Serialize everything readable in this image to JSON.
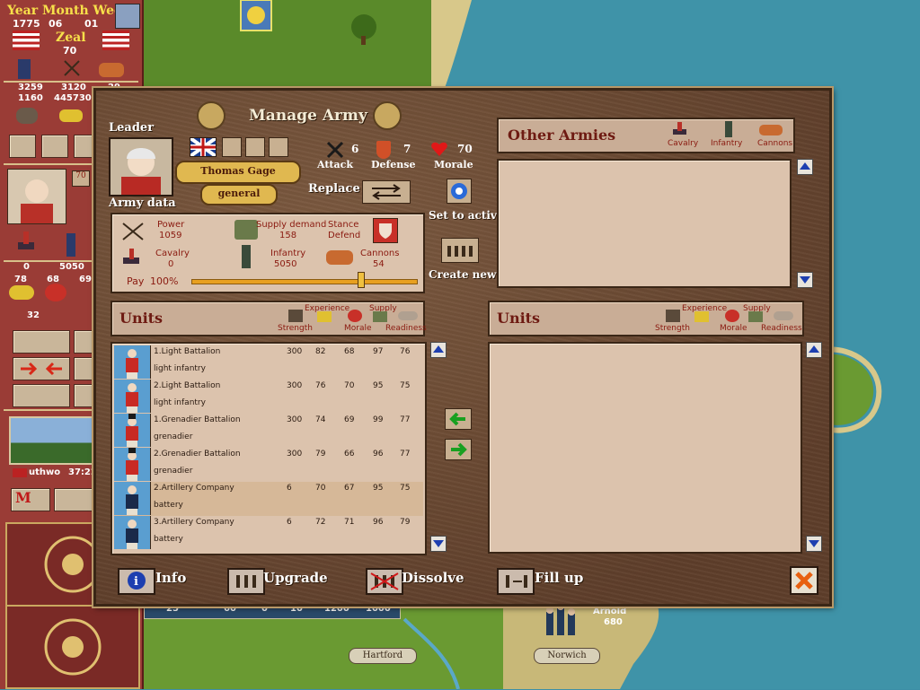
{
  "status": {
    "date_header": "Year Month Week",
    "year": "1775",
    "month": "06",
    "week": "01",
    "zeal_label": "Zeal",
    "zeal_value": "70",
    "res_row1": [
      "3259",
      "3120",
      "29"
    ],
    "res_row2": [
      "1160",
      "445730",
      ""
    ],
    "leader_badge": "70",
    "army_row": [
      "0",
      "5050",
      "0"
    ],
    "stat_row": [
      "78",
      "68",
      "69"
    ],
    "count": "32",
    "weather_name": "uthwo",
    "time": "37:22"
  },
  "map": {
    "units_bar": [
      "25",
      "60",
      "0",
      "10",
      "1200",
      "1000"
    ],
    "city1": "Hartford",
    "city2": "Norwich",
    "general_name": "Arnold",
    "general_strength": "680"
  },
  "dialog": {
    "title": "Manage Army",
    "leader_label": "Leader",
    "leader_name": "Thomas Gage",
    "leader_rank": "general",
    "army_data_label": "Army data",
    "attack_label": "Attack",
    "attack_value": "6",
    "defense_label": "Defense",
    "defense_value": "7",
    "morale_label": "Morale",
    "morale_value": "70",
    "replace_label": "Replace",
    "set_active_label": "Set to active",
    "create_new_label": "Create new",
    "army": {
      "power_label": "Power",
      "power_value": "1059",
      "supply_label": "Supply demand",
      "supply_value": "158",
      "stance_label": "Stance",
      "stance_value": "Defend",
      "cavalry_label": "Cavalry",
      "cavalry_value": "0",
      "infantry_label": "Infantry",
      "infantry_value": "5050",
      "cannons_label": "Cannons",
      "cannons_value": "54",
      "pay_label": "Pay",
      "pay_value": "100%",
      "pay_fraction": 0.75
    },
    "other_armies": {
      "title": "Other Armies",
      "col_cavalry": "Cavalry",
      "col_infantry": "Infantry",
      "col_cannons": "Cannons"
    },
    "units_left": {
      "title": "Units",
      "col_strength": "Strength",
      "col_experience": "Experience",
      "col_morale": "Morale",
      "col_supply": "Supply",
      "col_readiness": "Readiness",
      "rows": [
        {
          "name": "1.Light Battalion",
          "type": "light infantry",
          "strength": "300",
          "experience": "82",
          "morale": "68",
          "supply": "97",
          "readiness": "76",
          "selected": false,
          "kind": "infantry"
        },
        {
          "name": "2.Light Battalion",
          "type": "light infantry",
          "strength": "300",
          "experience": "76",
          "morale": "70",
          "supply": "95",
          "readiness": "75",
          "selected": false,
          "kind": "infantry"
        },
        {
          "name": "1.Grenadier Battalion",
          "type": "grenadier",
          "strength": "300",
          "experience": "74",
          "morale": "69",
          "supply": "99",
          "readiness": "77",
          "selected": false,
          "kind": "grenadier"
        },
        {
          "name": "2.Grenadier Battalion",
          "type": "grenadier",
          "strength": "300",
          "experience": "79",
          "morale": "66",
          "supply": "96",
          "readiness": "77",
          "selected": false,
          "kind": "grenadier"
        },
        {
          "name": "2.Artillery Company",
          "type": "battery",
          "strength": "6",
          "experience": "70",
          "morale": "67",
          "supply": "95",
          "readiness": "75",
          "selected": true,
          "kind": "artillery"
        },
        {
          "name": "3.Artillery Company",
          "type": "battery",
          "strength": "6",
          "experience": "72",
          "morale": "71",
          "supply": "96",
          "readiness": "79",
          "selected": false,
          "kind": "artillery"
        }
      ]
    },
    "units_right": {
      "title": "Units",
      "col_strength": "Strength",
      "col_experience": "Experience",
      "col_morale": "Morale",
      "col_supply": "Supply",
      "col_readiness": "Readiness"
    },
    "buttons": {
      "info": "Info",
      "upgrade": "Upgrade",
      "dissolve": "Dissolve",
      "fill_up": "Fill up"
    },
    "colors": {
      "dialog_bg": "#6d4a33",
      "panel_bg": "#dcc3ad",
      "header_text": "#6e1a12",
      "selected_row": "#d6b898"
    }
  }
}
